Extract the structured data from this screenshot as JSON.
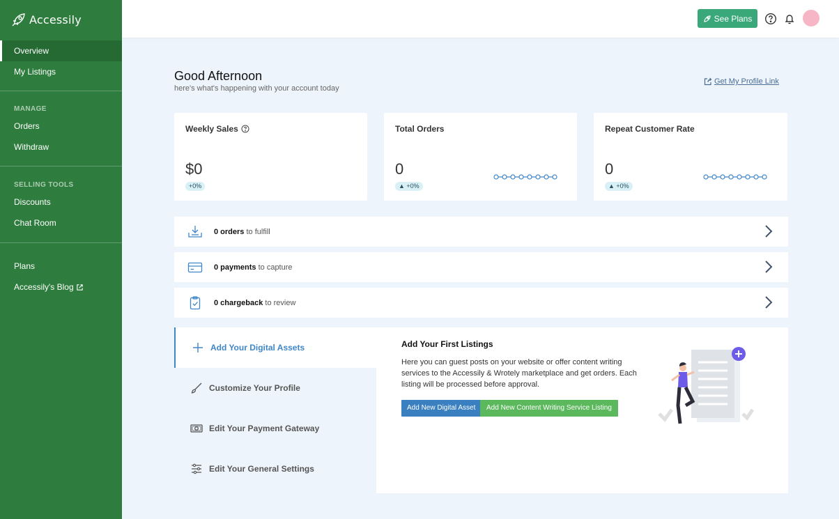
{
  "brand": {
    "name": "Accessily"
  },
  "sidebar": {
    "items": [
      {
        "label": "Overview"
      },
      {
        "label": "My Listings"
      }
    ],
    "manage": {
      "title": "MANAGE",
      "items": [
        {
          "label": "Orders"
        },
        {
          "label": "Withdraw"
        }
      ]
    },
    "selling_tools": {
      "title": "SELLING TOOLS",
      "items": [
        {
          "label": "Discounts"
        },
        {
          "label": "Chat Room"
        }
      ]
    },
    "extra": {
      "items": [
        {
          "label": "Plans"
        },
        {
          "label": "Accessily's Blog"
        }
      ]
    }
  },
  "topbar": {
    "see_plans": "See Plans",
    "icons": [
      "help-icon",
      "bell-icon",
      "avatar"
    ]
  },
  "greeting": {
    "title": "Good Afternoon",
    "subtitle": "here's what's happening with your account today",
    "profile_link": "Get My Profile Link"
  },
  "stats": [
    {
      "title": "Weekly Sales",
      "value": "$0",
      "change": "+0%"
    },
    {
      "title": "Total Orders",
      "value": "0",
      "change": "+0%"
    },
    {
      "title": "Repeat Customer Rate",
      "value": "0",
      "change": "+0%"
    }
  ],
  "tasks": [
    {
      "count": "0 orders",
      "rest": "to fulfill"
    },
    {
      "count": "0 payments",
      "rest": "to capture"
    },
    {
      "count": "0 chargeback",
      "rest": "to review"
    }
  ],
  "onboarding": {
    "steps": [
      {
        "label": "Add Your Digital Assets"
      },
      {
        "label": "Customize Your Profile"
      },
      {
        "label": "Edit Your Payment Gateway"
      },
      {
        "label": "Edit Your General Settings"
      }
    ],
    "panel_title": "Add Your First Listings",
    "panel_desc": "Here you can guest posts on your website or offer content writing services to the Accessily & Wrotely marketplace and get orders. Each listing will be processed before approval.",
    "btn_primary": "Add New Digital Asset",
    "btn_secondary": "Add New Content Writing Service Listing"
  },
  "colors": {
    "sidebar": "#2e7d3e",
    "accent_green": "#3aa879",
    "accent_blue": "#3f86c8",
    "background": "#eef4fb"
  }
}
